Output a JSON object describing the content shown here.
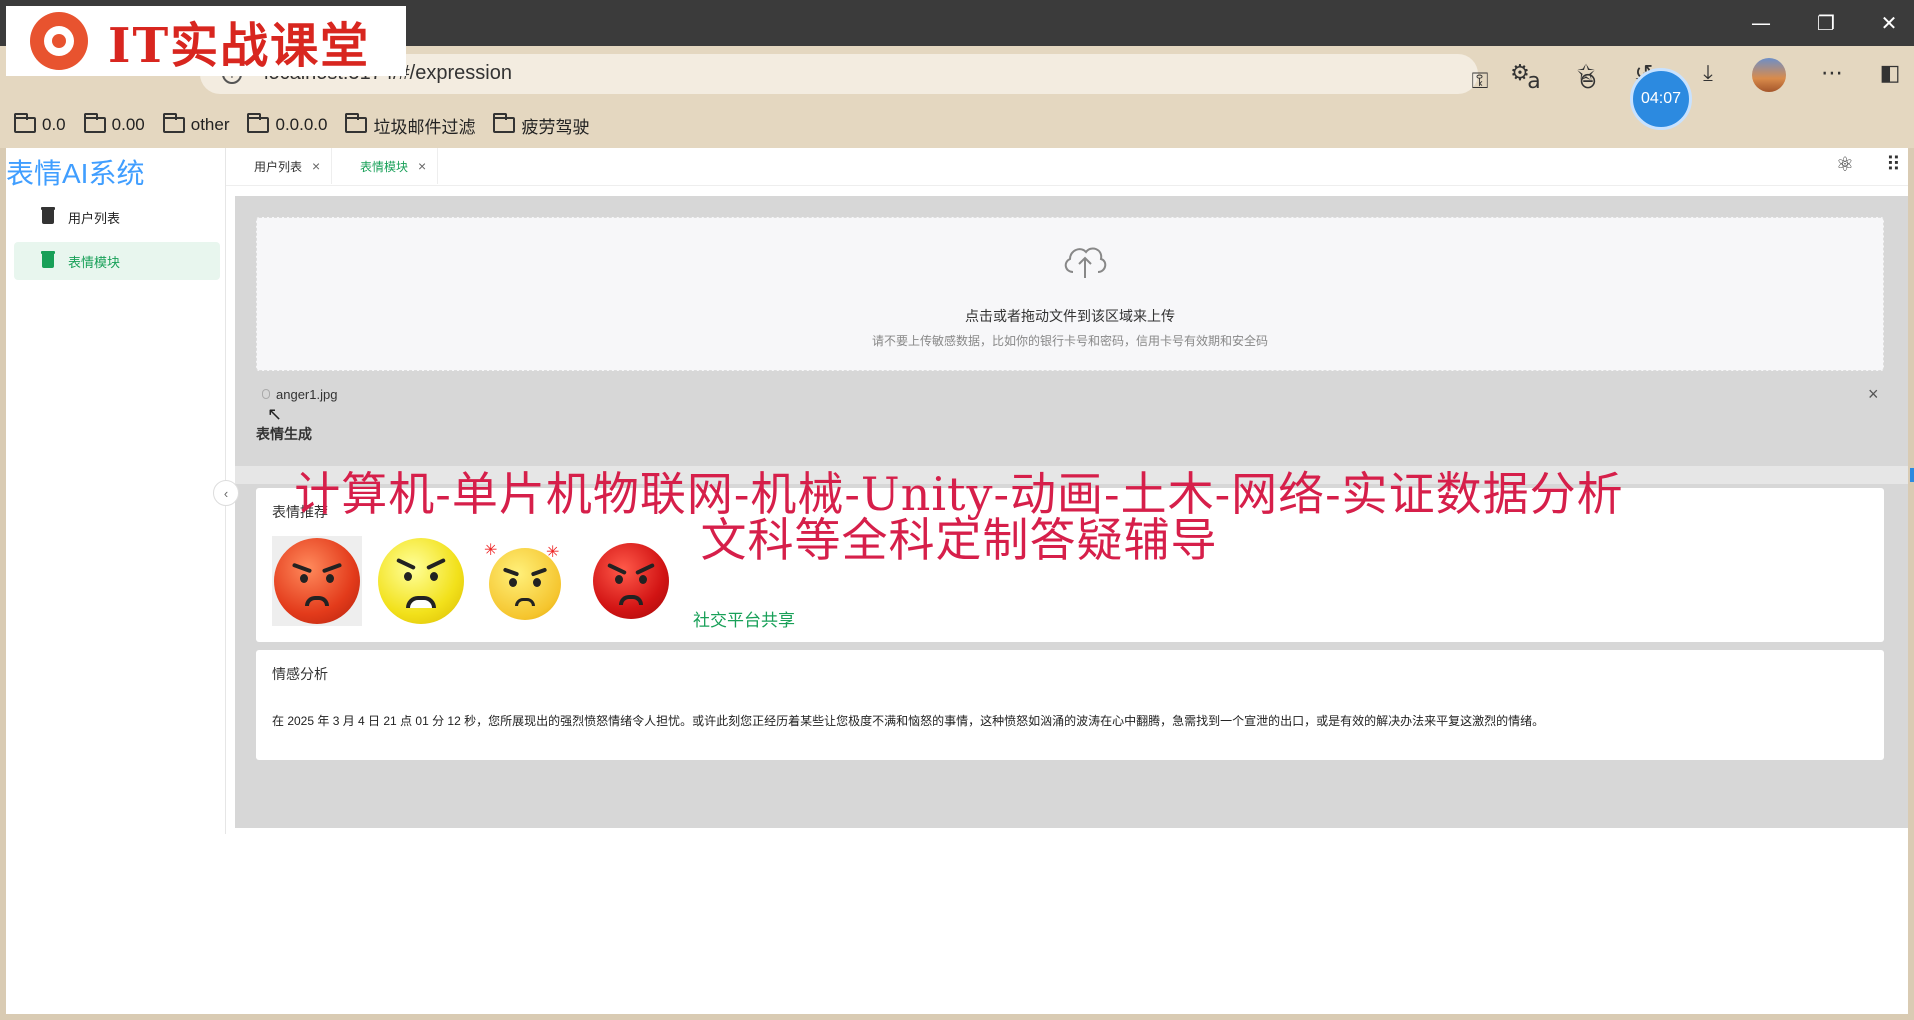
{
  "browser": {
    "url": "localhost:5174/#/expression",
    "timer": "04:07",
    "window_controls": {
      "minimize": "—",
      "maximize": "❐",
      "close": "✕"
    },
    "bookmarks": [
      {
        "label": "0.0"
      },
      {
        "label": "0.00"
      },
      {
        "label": "other"
      },
      {
        "label": "0.0.0.0"
      },
      {
        "label": "垃圾邮件过滤"
      },
      {
        "label": "疲劳驾驶"
      }
    ]
  },
  "watermark": {
    "logo_text": "IT实战课堂",
    "overlay_line1": "计算机-单片机物联网-机械-Unity-动画-土木-网络-实证数据分析",
    "overlay_line2": "文科等全科定制答疑辅导"
  },
  "app": {
    "title": "表情AI系统",
    "menu": [
      {
        "label": "用户列表",
        "active": false
      },
      {
        "label": "表情模块",
        "active": true
      }
    ],
    "tabs": [
      {
        "label": "用户列表",
        "active": false
      },
      {
        "label": "表情模块",
        "active": true
      }
    ]
  },
  "upload": {
    "title": "点击或者拖动文件到该区域来上传",
    "hint": "请不要上传敏感数据，比如你的银行卡号和密码，信用卡号有效期和安全码",
    "file_name": "anger1.jpg"
  },
  "generation": {
    "section_title": "表情生成"
  },
  "recommend": {
    "title": "表情推荐",
    "emojis": [
      "angry-face-emoji",
      "frustrated-face-emoji",
      "annoyed-face-emoji",
      "red-angry-face-emoji"
    ],
    "share_label": "社交平台共享"
  },
  "analysis": {
    "title": "情感分析",
    "text": "在 2025 年 3 月 4 日 21 点 01 分 12 秒，您所展现出的强烈愤怒情绪令人担忧。或许此刻您正经历着某些让您极度不满和恼怒的事情，这种愤怒如汹涌的波涛在心中翻腾，急需找到一个宣泄的出口，或是有效的解决办法来平复这激烈的情绪。"
  },
  "colors": {
    "accent_green": "#18a058",
    "title_blue": "#409eff",
    "overlay_red": "#d61f4a"
  }
}
